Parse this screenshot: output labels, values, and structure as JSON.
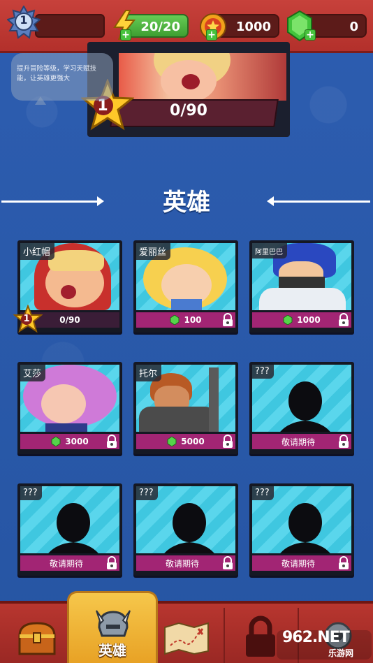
{
  "topbar": {
    "player_level": "1",
    "energy": "20/20",
    "coins": "1000",
    "gems": "0"
  },
  "tooltip": {
    "text": "提升冒险等级，学习天赋技能，让英雄更强大"
  },
  "featured": {
    "star_level": "1",
    "progress": "0/90"
  },
  "section": {
    "title": "英雄"
  },
  "heroes": [
    {
      "name": "小红帽",
      "level": "1",
      "status": "0/90",
      "locked": false
    },
    {
      "name": "爱丽丝",
      "cost": "100",
      "locked": true
    },
    {
      "name": "阿里巴巴",
      "cost": "1000",
      "locked": true
    },
    {
      "name": "艾莎",
      "cost": "3000",
      "locked": true
    },
    {
      "name": "托尔",
      "cost": "5000",
      "locked": true
    },
    {
      "name": "???",
      "status": "敬请期待",
      "locked": true
    },
    {
      "name": "???",
      "status": "敬请期待",
      "locked": true
    },
    {
      "name": "???",
      "status": "敬请期待",
      "locked": true
    },
    {
      "name": "???",
      "status": "敬请期待",
      "locked": true
    }
  ],
  "nav": {
    "active_label": "英雄",
    "items": [
      "treasure-chest",
      "hero-helmet",
      "map",
      "locked",
      "settings"
    ]
  },
  "watermark": {
    "brand": "962.NET",
    "sub": "乐游网"
  },
  "colors": {
    "background": "#2a59a8",
    "topbar": "#c7413b",
    "price_bar": "#a22574",
    "card_art": "#3fc7e0",
    "active_tab": "#f6c74b"
  }
}
